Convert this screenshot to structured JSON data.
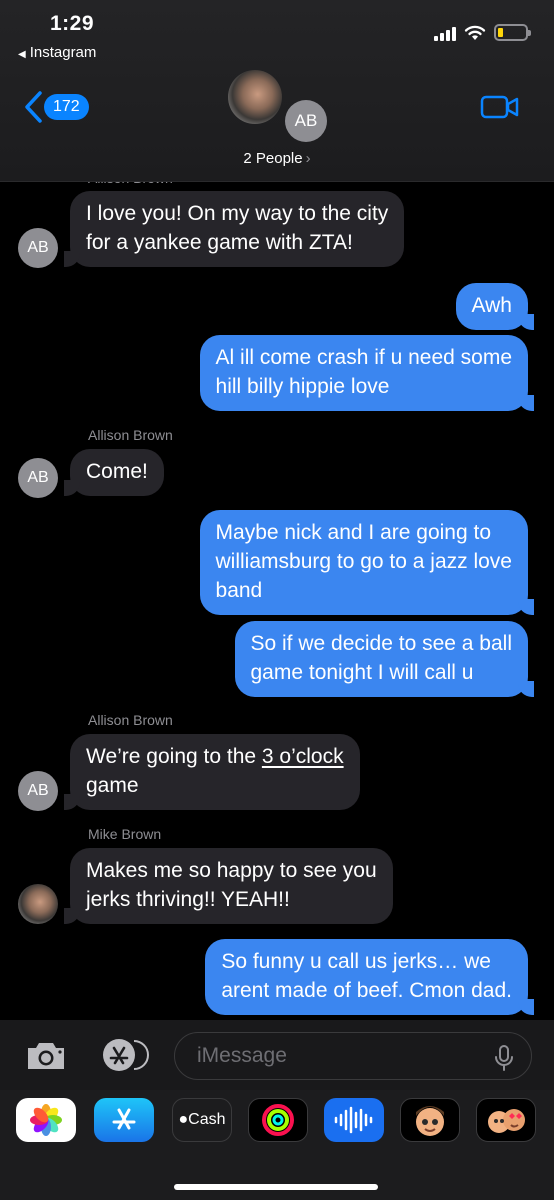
{
  "status_bar": {
    "time": "1:29",
    "back_app": "Instagram",
    "battery_color": "#ffd60a"
  },
  "header": {
    "back_count": "172",
    "group_initials": "AB",
    "people_label": "2 People",
    "icons": [
      "chevron-left-icon",
      "video-camera-icon"
    ]
  },
  "thread": {
    "partial_name": "Allison Brown",
    "messages": [
      {
        "direction": "in",
        "avatar": "AB",
        "lines": [
          "I love you! On my way to the city",
          "for a yankee game with ZTA!"
        ]
      },
      {
        "direction": "out",
        "text": "Awh"
      },
      {
        "direction": "out",
        "lines": [
          "Al ill come crash if u need some",
          "hill billy hippie love"
        ]
      },
      {
        "direction": "in",
        "sender": "Allison Brown",
        "avatar": "AB",
        "text": "Come!"
      },
      {
        "direction": "out",
        "lines": [
          "Maybe nick and I are going to",
          "williamsburg to go to a jazz love",
          "band"
        ]
      },
      {
        "direction": "out",
        "lines": [
          "So if we decide to see a ball",
          "game tonight I will call u"
        ]
      },
      {
        "direction": "in",
        "sender": "Allison Brown",
        "avatar": "AB",
        "text_before": "We’re going to the ",
        "link": "3 o’clock",
        "text_after": "game"
      },
      {
        "direction": "in",
        "sender": "Mike Brown",
        "avatar": "photo",
        "lines": [
          "Makes me so happy to see you",
          "jerks thriving!! YEAH!!"
        ]
      },
      {
        "direction": "out",
        "lines": [
          "So funny u call us jerks… we",
          "arent made of beef. Cmon dad."
        ]
      }
    ]
  },
  "composer": {
    "placeholder": "iMessage",
    "icons": [
      "camera-icon",
      "app-store-icon",
      "microphone-icon"
    ]
  },
  "app_drawer": {
    "apps": [
      "Photos",
      "App Store",
      "Cash",
      "Activity",
      "Audio Message",
      "Memoji",
      "Memoji Stickers"
    ],
    "cash_label": "Cash"
  }
}
